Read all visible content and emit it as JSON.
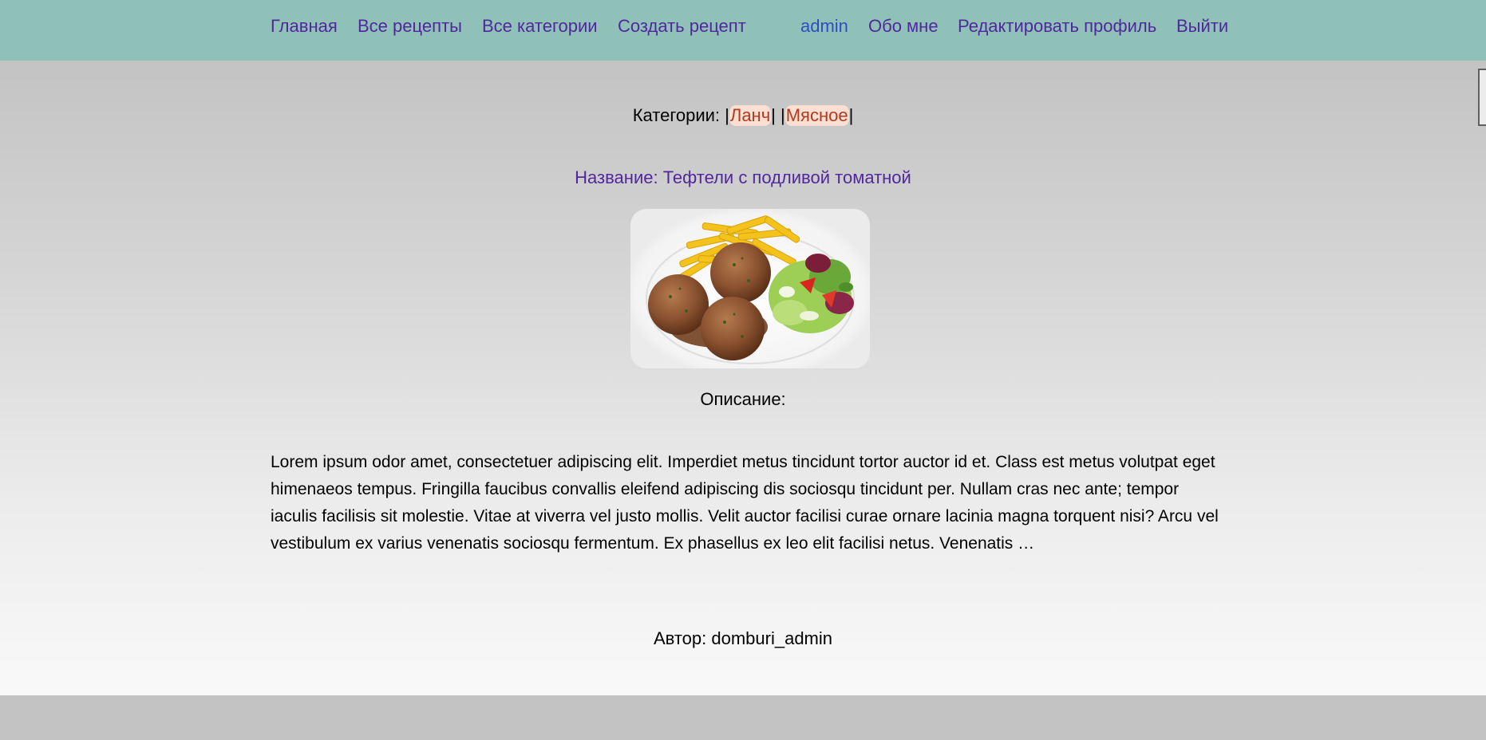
{
  "nav": {
    "home": "Главная",
    "all_recipes": "Все рецепты",
    "all_categories": "Все категории",
    "create_recipe": "Создать рецепт",
    "user": "admin",
    "about": "Обо мне",
    "edit_profile": "Редактировать профиль",
    "logout": "Выйти"
  },
  "recipe": {
    "categories_label": "Категории: ",
    "categories": [
      "Ланч",
      "Мясное"
    ],
    "title": "Название: Тефтели с подливой томатной",
    "image_alt": "meatballs-with-fries-and-salad",
    "description_label": "Описание:",
    "description": "Lorem ipsum odor amet, consectetuer adipiscing elit. Imperdiet metus tincidunt tortor auctor id et. Class est metus volutpat eget himenaeos tempus. Fringilla faucibus convallis eleifend adipiscing dis sociosqu tincidunt per. Nullam cras nec ante; tempor iaculis facilisis sit molestie. Vitae at viverra vel justo mollis. Velit auctor facilisi curae ornare lacinia magna torquent nisi? Arcu vel vestibulum ex varius venenatis sociosqu fermentum. Ex phasellus ex leo elit facilisi netus. Venenatis …",
    "author": "Автор: domburi_admin"
  },
  "colors": {
    "navbar": "#8fc1b9",
    "nav_link": "#51279e",
    "user_link": "#2c4dc4",
    "category_bg": "#fbdfd2",
    "category_text": "#b03a20"
  }
}
